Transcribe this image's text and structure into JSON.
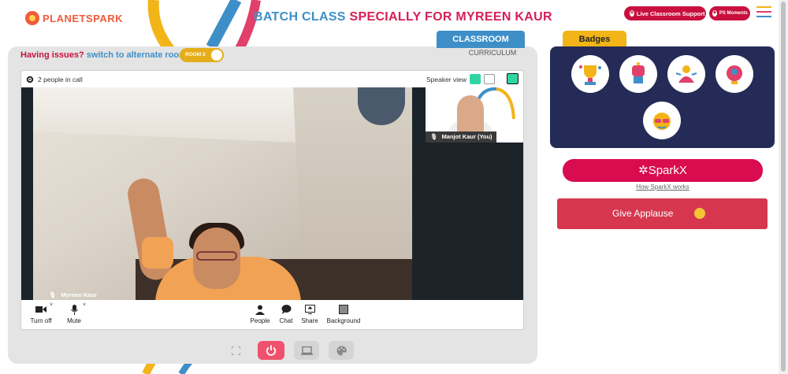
{
  "header": {
    "logo_text": "PLANETSPARK",
    "title_part1": "BATCH CLASS ",
    "title_part2": "SPECIALLY FOR MYREEN KAUR",
    "live_support_label": "Live Classroom Support",
    "ps_moments_label": "PS Moments"
  },
  "tabs": {
    "classroom": "CLASSROOM",
    "curriculum": "CURRICULUM"
  },
  "issues": {
    "question": "Having issues?",
    "switch_text": "switch to alternate room",
    "room_label": "ROOM 2"
  },
  "call": {
    "people_count": "2 people in call",
    "view_mode": "Speaker view",
    "main_participant": "Myreen Kaur",
    "self_participant": "Manjot Kaur (You)"
  },
  "controls": {
    "camera": "Turn off",
    "mic": "Mute",
    "people": "People",
    "chat": "Chat",
    "share": "Share",
    "background": "Background"
  },
  "badges": {
    "title": "Badges",
    "items": [
      "trophy-badge-icon",
      "fist-badge-icon",
      "sparkle-person-badge-icon",
      "idea-badge-icon",
      "glasses-face-badge-icon"
    ]
  },
  "sparkx": {
    "label": "SparkX",
    "link": "How SparkX works"
  },
  "applause": {
    "label": "Give Applause"
  },
  "colors": {
    "accent_blue": "#3e8fc8",
    "accent_red": "#d61f56",
    "badge_panel": "#242b56",
    "badge_tab": "#f2b417",
    "active_view": "#2fd6a3"
  }
}
